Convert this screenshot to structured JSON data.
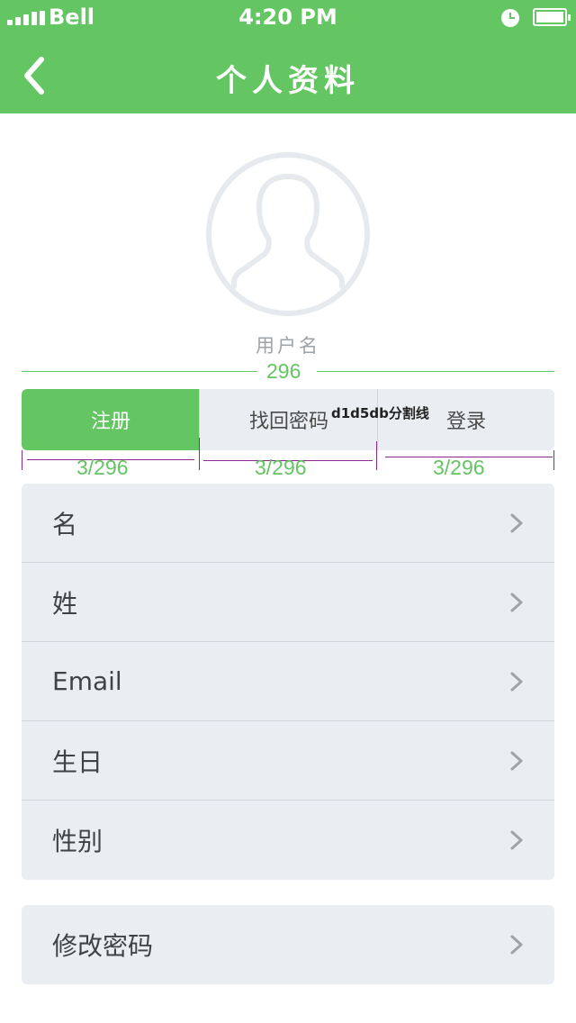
{
  "status": {
    "carrier": "Bell",
    "time": "4:20 PM"
  },
  "nav": {
    "title": "个人资料",
    "back_icon": "chevron-left-icon"
  },
  "profile": {
    "username": "用户名",
    "avatar_icon": "user-avatar-icon"
  },
  "annotations": {
    "width_label": "296",
    "seg_width_1": "3/296",
    "seg_width_2": "3/296",
    "seg_width_3": "3/296",
    "divider_note": "d1d5db分割线"
  },
  "segmented": {
    "items": [
      {
        "label": "注册",
        "active": true
      },
      {
        "label": "找回密码",
        "active": false
      },
      {
        "label": "登录",
        "active": false
      }
    ]
  },
  "info_list": {
    "items": [
      {
        "label": "名"
      },
      {
        "label": "姓"
      },
      {
        "label": "Email"
      },
      {
        "label": "生日"
      },
      {
        "label": "性别"
      }
    ]
  },
  "security_list": {
    "items": [
      {
        "label": "修改密码"
      }
    ]
  },
  "colors": {
    "primary": "#64c563",
    "list_bg": "#eaedf1",
    "divider": "#d1d5db",
    "text": "#3f4347",
    "muted": "#9ea3a8"
  }
}
